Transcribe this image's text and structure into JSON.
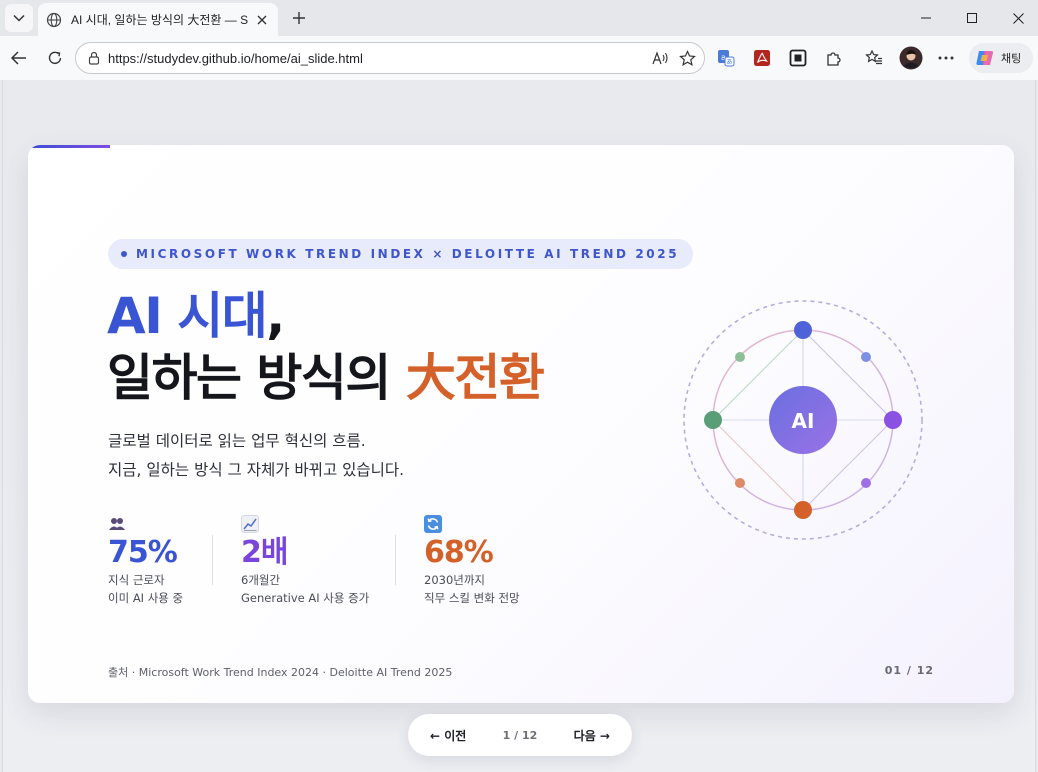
{
  "browser": {
    "tab_title": "AI 시대, 일하는 방식의 大전환 — S",
    "url": "https://studydev.github.io/home/ai_slide.html",
    "copilot_label": "채팅",
    "icons": [
      "tab-actions-icon",
      "globe-icon",
      "close-icon",
      "new-tab-icon",
      "minimize-icon",
      "maximize-icon",
      "close-window-icon",
      "back-icon",
      "refresh-icon",
      "lock-icon",
      "read-aloud-icon",
      "favorite-star-icon",
      "translate-icon",
      "pdf-icon",
      "screenshot-icon",
      "extensions-icon",
      "favorites-icon",
      "profile-avatar",
      "more-icon",
      "copilot-icon"
    ]
  },
  "slide": {
    "tag": "MICROSOFT WORK TREND INDEX × DELOITTE AI TREND 2025",
    "headline": {
      "line1_accent": "AI 시대",
      "line1_rest": ",",
      "line2_main": "일하는 방식의 ",
      "line2_accent": "大전환"
    },
    "subtitle": {
      "line1": "글로벌 데이터로 읽는 업무 혁신의 흐름.",
      "line2": "지금, 일하는 방식 그 자체가 바뀌고 있습니다."
    },
    "stats": [
      {
        "icon": "people-icon",
        "value": "75%",
        "label1": "지식 근로자",
        "label2": "이미 AI 사용 중",
        "color": "#3a55d3"
      },
      {
        "icon": "chart-up-icon",
        "value": "2배",
        "label1": "6개월간",
        "label2": "Generative AI 사용 증가",
        "color": "#7a45dd"
      },
      {
        "icon": "refresh-cycle-icon",
        "value": "68%",
        "label1": "2030년까지",
        "label2": "직무 스킬 변화 전망",
        "color": "#d4612a"
      }
    ],
    "source": "출처 · Microsoft Work Trend Index 2024 · Deloitte AI Trend 2025",
    "page_number": "01 / 12",
    "diagram_center_label": "AI",
    "colors": {
      "blue": "#3a55d3",
      "purple": "#7a45dd",
      "orange": "#d4612a",
      "green": "#5a9e78"
    }
  },
  "pager": {
    "prev": "← 이전",
    "count": "1 / 12",
    "next": "다음 →"
  }
}
